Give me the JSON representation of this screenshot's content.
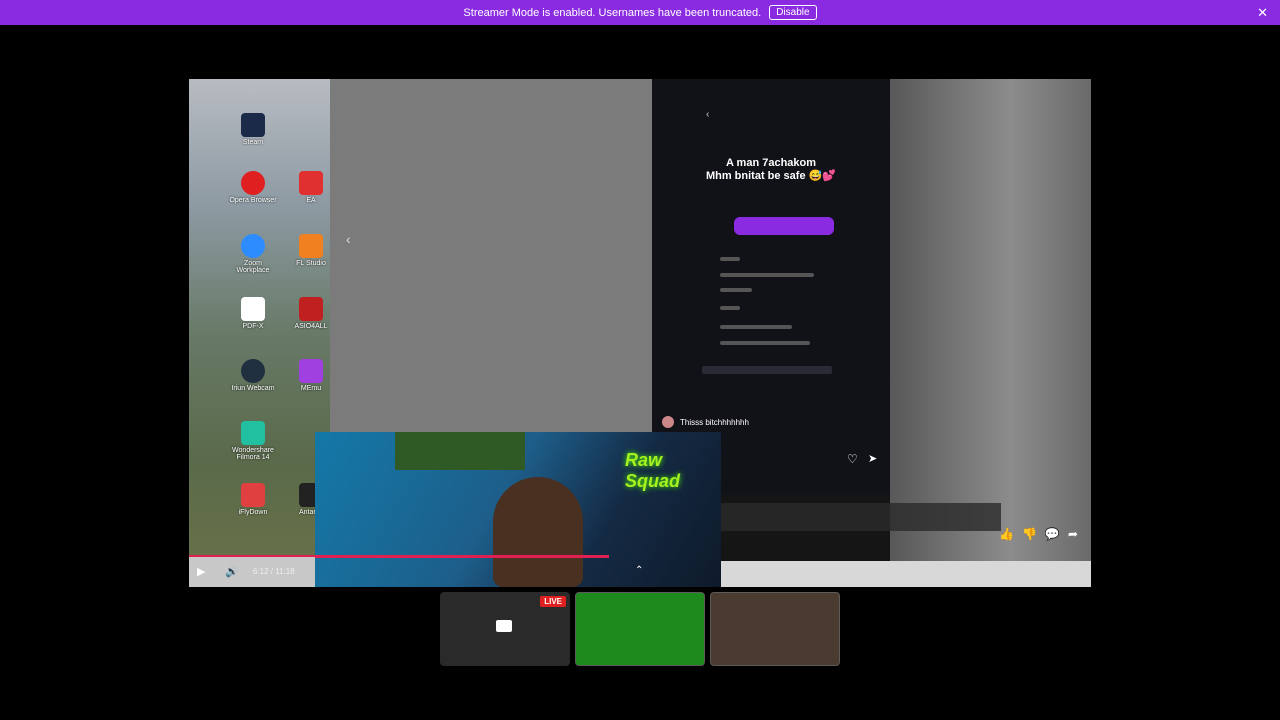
{
  "banner": {
    "message": "Streamer Mode is enabled. Usernames have been truncated.",
    "button": "Disable"
  },
  "desktop": {
    "icons": [
      "Steam",
      "Opera Browser",
      "EA",
      "Zoom Workplace",
      "FL Studio",
      "PDF-X",
      "ASIO4ALL",
      "Iriun Webcam",
      "MEmu",
      "Wondershare Filmora 14",
      "iFlyDown",
      "Antares"
    ]
  },
  "phone": {
    "headline_line1": "A man 7achakom",
    "headline_line2": "Mhm bnitat be safe 😅💕",
    "comment": "Thisss bitchhhhhhh"
  },
  "webcam": {
    "logo": "Raw Squad"
  },
  "player": {
    "time": "6:12 / 11:18"
  },
  "tiles": {
    "live": "LIVE"
  }
}
